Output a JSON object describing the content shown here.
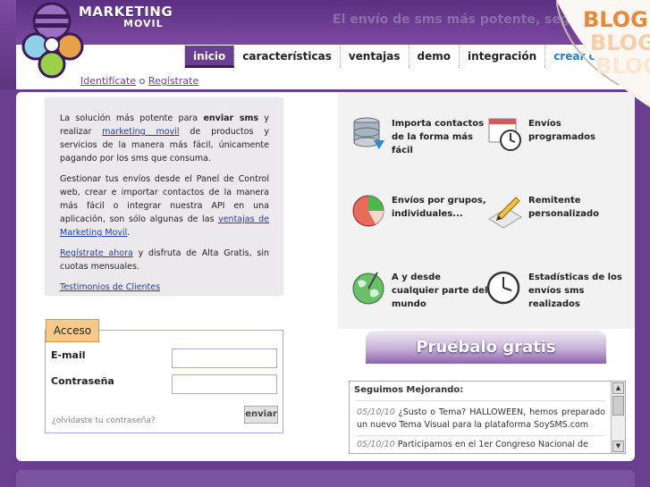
{
  "brand": {
    "name_line1": "MARKETING",
    "name_line2": "MOVIL",
    "slogan": "El envío de sms más potente, seguro y si",
    "colors": {
      "primary": "#6b3f8f",
      "accent": "#f7c98a",
      "link": "#1d3fa3",
      "nav_last": "#1a7fd0"
    }
  },
  "nav": {
    "items": [
      {
        "label": "inicio",
        "active": true
      },
      {
        "label": "características"
      },
      {
        "label": "ventajas"
      },
      {
        "label": "demo"
      },
      {
        "label": "integración"
      },
      {
        "label": "crear c"
      }
    ]
  },
  "auth": {
    "login_link": "Identifícate",
    "separator": "o",
    "register_link": "Regístrate"
  },
  "blog_corner": {
    "label": "BLOG"
  },
  "info": {
    "p1_pre": "La solución más potente para",
    "p1_bold": "enviar sms",
    "p1_mid": "y realizar",
    "p1_link": "marketing movil",
    "p1_post": "de productos y servicios de la manera más fácil, únicamente pagando por los sms que consuma.",
    "p2_pre": "Gestionar tus envíos desde el Panel de Control web, crear e importar contactos de la manera más fácil o integrar nuestra API en una aplicación, son sólo algunas de las",
    "p2_link": "ventajas de Marketing Movil",
    "p2_post": ".",
    "p3_link": "Regístrate ahora",
    "p3_post": "y disfruta de Alta Gratis, sin cuotas mensuales.",
    "p4_link": "Testimonios de Clientes"
  },
  "login": {
    "tab": "Acceso",
    "email_label": "E-mail",
    "password_label": "Contraseña",
    "forgot": "¿olvidaste tu contraseña?",
    "submit": "enviar"
  },
  "features": [
    {
      "icon": "database-import-icon",
      "label": "Importa contactos de la forma más fácil"
    },
    {
      "icon": "calendar-clock-icon",
      "label": "Envíos programados"
    },
    {
      "icon": "pie-chart-icon",
      "label": "Envíos por grupos, individuales..."
    },
    {
      "icon": "pencil-edit-icon",
      "label": "Remitente personalizado"
    },
    {
      "icon": "globe-icon",
      "label": "A y desde cualquier parte del mundo"
    },
    {
      "icon": "clock-stats-icon",
      "label": "Estadísticas de los envíos sms realizados"
    }
  ],
  "try_banner": {
    "label": "Pruébalo gratis"
  },
  "news": {
    "title": "Seguimos Mejorando:",
    "items": [
      {
        "date": "05/10/10",
        "text": "¿Susto o Tema? HALLOWEEN, hemos preparado un nuevo Tema Visual para la plataforma SoySMS.com"
      },
      {
        "date": "05/10/10",
        "text": "Participamos en el 1er Congreso Nacional de"
      }
    ]
  }
}
